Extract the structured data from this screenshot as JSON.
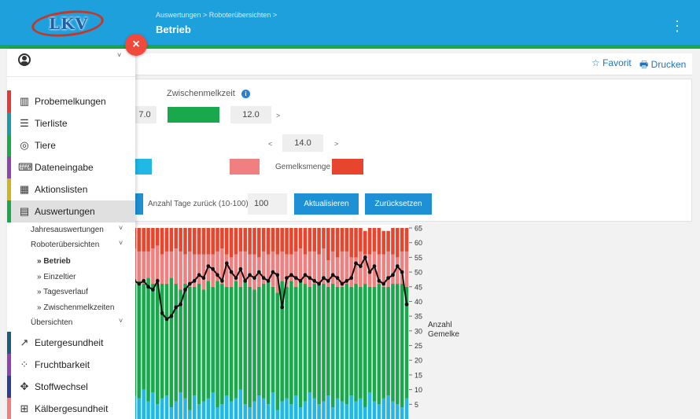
{
  "header": {
    "logo_text": "LKV",
    "breadcrumb": "Auswertungen > Roboterübersichten >",
    "title": "Betrieb",
    "menu_glyph": "⋮"
  },
  "actions": {
    "favorit": "☆ Favorit",
    "drucken": "🖶 Drucken"
  },
  "sidebar": {
    "close_glyph": "×",
    "user_caret": "˅",
    "items": [
      {
        "label": "Probemelkungen",
        "icon": "bar-chart-icon",
        "glyph": "▥",
        "color": "#e53935"
      },
      {
        "label": "Tierliste",
        "icon": "list-icon",
        "glyph": "☰",
        "color": "#1b9aaa"
      },
      {
        "label": "Tiere",
        "icon": "target-icon",
        "glyph": "◎",
        "color": "#19a84b"
      },
      {
        "label": "Dateneingabe",
        "icon": "keyboard-icon",
        "glyph": "⌨",
        "color": "#8e44ad"
      },
      {
        "label": "Aktionslisten",
        "icon": "calendar-icon",
        "glyph": "▦",
        "color": "#c9b81c"
      },
      {
        "label": "Auswertungen",
        "icon": "report-icon",
        "glyph": "▤",
        "color": "#19a84b"
      },
      {
        "label": "Eutergesundheit",
        "icon": "line-chart-icon",
        "glyph": "↗",
        "color": "#1e5b7a"
      },
      {
        "label": "Fruchtbarkeit",
        "icon": "spinner-icon",
        "glyph": "⁘",
        "color": "#8e44ad"
      },
      {
        "label": "Stoffwechsel",
        "icon": "crosshair-icon",
        "glyph": "✥",
        "color": "#2c3e8f"
      },
      {
        "label": "Kälbergesundheit",
        "icon": "plus-box-icon",
        "glyph": "⊞",
        "color": "#f08080"
      }
    ],
    "submenu": [
      {
        "label": "Jahresauswertungen",
        "caret": "˅"
      },
      {
        "label": "Roboterübersichten",
        "caret": "˅"
      },
      {
        "label": "» Betrieb"
      },
      {
        "label": "» Einzeltier"
      },
      {
        "label": "» Tagesverlauf"
      },
      {
        "label": "» Zwischenmelkzeiten"
      },
      {
        "label": "Übersichten",
        "caret": "˅"
      }
    ]
  },
  "filters": {
    "zwischenmelkzeit_label": "Zwischenmelkzeit",
    "info_glyph": "i",
    "value_left": "7.0",
    "value_right": "12.0",
    "value_mid": "14.0",
    "arrow_right": ">",
    "arrow_left": "<",
    "gemelksmenge_label": "Gemelksmenge",
    "tage_label": "Anzahl Tage zurück (10-100):",
    "tage_value": "100",
    "btn_aktualisieren": "Aktualisieren",
    "btn_zuruecksetzen": "Zurücksetzen",
    "colors": {
      "green": "#19a84b",
      "cyan": "#22b8e6",
      "pink": "#f08080",
      "red": "#e8452f"
    }
  },
  "chart_data": {
    "type": "bar",
    "ylabel": "Anzahl\nGemelke",
    "ylim": [
      0,
      65
    ],
    "yticks": [
      5,
      10,
      15,
      20,
      25,
      30,
      35,
      40,
      45,
      50,
      55,
      60,
      65
    ],
    "series": [
      {
        "name": "",
        "color": "#22b8e6",
        "values": [
          8,
          7,
          10,
          6,
          9,
          5,
          7,
          8,
          4,
          6,
          9,
          7,
          3,
          8,
          5,
          6,
          7,
          9,
          4,
          5,
          8,
          6,
          7,
          10,
          5,
          4,
          6,
          8,
          7,
          5,
          9,
          3,
          6,
          7,
          5,
          8,
          4,
          6,
          9,
          7,
          5,
          6,
          8,
          4,
          7,
          6,
          5,
          8,
          6,
          7,
          4,
          9,
          6,
          5,
          7,
          8,
          6,
          5,
          4,
          7
        ]
      },
      {
        "name": "",
        "color": "#19a84b",
        "values": [
          38,
          40,
          36,
          42,
          37,
          41,
          39,
          38,
          44,
          40,
          35,
          39,
          42,
          37,
          41,
          38,
          40,
          36,
          43,
          41,
          37,
          39,
          40,
          35,
          42,
          41,
          38,
          37,
          39,
          42,
          36,
          40,
          41,
          38,
          42,
          37,
          43,
          40,
          36,
          39,
          41,
          40,
          37,
          42,
          38,
          39,
          41,
          37,
          40,
          38,
          42,
          36,
          39,
          41,
          38,
          37,
          40,
          41,
          42,
          38
        ]
      },
      {
        "name": "",
        "color": "#f08080",
        "values": [
          12,
          10,
          11,
          9,
          12,
          13,
          10,
          11,
          9,
          12,
          13,
          10,
          12,
          11,
          10,
          12,
          9,
          11,
          10,
          12,
          11,
          10,
          9,
          12,
          10,
          11,
          12,
          10,
          11,
          9,
          12,
          13,
          10,
          11,
          9,
          12,
          11,
          10,
          12,
          11,
          10,
          12,
          9,
          11,
          10,
          12,
          11,
          10,
          9,
          12,
          10,
          11,
          12,
          10,
          11,
          12,
          10,
          9,
          11,
          12
        ]
      },
      {
        "name": "",
        "color": "#e8452f",
        "values": [
          7,
          8,
          8,
          8,
          7,
          6,
          9,
          8,
          8,
          7,
          8,
          9,
          8,
          9,
          9,
          9,
          9,
          9,
          8,
          7,
          9,
          10,
          9,
          8,
          8,
          9,
          9,
          10,
          8,
          9,
          8,
          9,
          8,
          9,
          9,
          8,
          7,
          9,
          8,
          8,
          9,
          7,
          11,
          8,
          10,
          8,
          8,
          10,
          10,
          8,
          8,
          9,
          8,
          9,
          8,
          7,
          9,
          10,
          8,
          8
        ]
      },
      {
        "name": "",
        "color": "#111111",
        "type": "line",
        "values": [
          47,
          46,
          47,
          45,
          44,
          47,
          36,
          34,
          35,
          38,
          39,
          44,
          46,
          47,
          49,
          48,
          52,
          51,
          49,
          47,
          53,
          50,
          48,
          51,
          47,
          49,
          48,
          50,
          48,
          47,
          50,
          49,
          38,
          48,
          49,
          48,
          47,
          49,
          48,
          47,
          46,
          48,
          47,
          49,
          48,
          46,
          47,
          48,
          53,
          52,
          55,
          50,
          52,
          47,
          46,
          48,
          49,
          52,
          50,
          39
        ]
      }
    ]
  }
}
